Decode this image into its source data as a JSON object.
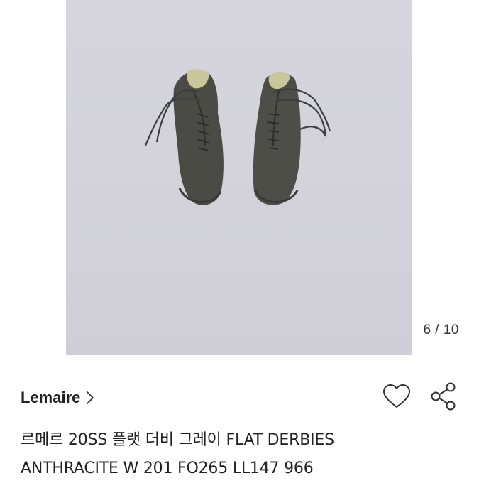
{
  "gallery": {
    "counter": "6 / 10",
    "image_alt": "lace-up leather flat derby shoes, dark grey, on light grey backdrop"
  },
  "product": {
    "brand": "Lemaire",
    "brand_chevron_icon": "chevron-right-icon",
    "like_icon": "heart-outline-icon",
    "share_icon": "share-icon",
    "title_line1": "르메르 20SS 플랫 더비 그레이 FLAT DERBIES",
    "title_line2": "ANTHRACITE W 201 FO265 LL147 966"
  }
}
